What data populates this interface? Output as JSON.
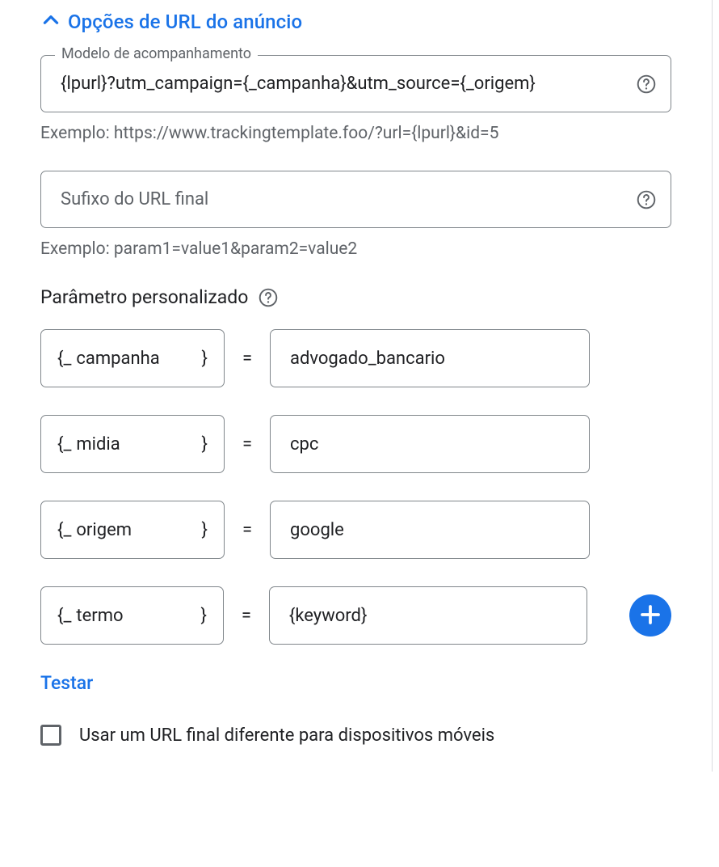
{
  "header": {
    "title": "Opções de URL do anúncio"
  },
  "tracking_template": {
    "label": "Modelo de acompanhamento",
    "value": "{lpurl}?utm_campaign={_campanha}&utm_source={_origem}",
    "example": "Exemplo: https://www.trackingtemplate.foo/?url={lpurl}&id=5"
  },
  "final_url_suffix": {
    "placeholder": "Sufixo do URL final",
    "value": "",
    "example": "Exemplo: param1=value1&param2=value2"
  },
  "custom_params": {
    "heading": "Parâmetro personalizado",
    "prefix": "{_",
    "suffix": "}",
    "eq": "=",
    "rows": [
      {
        "key": "campanha",
        "value": "advogado_bancario"
      },
      {
        "key": "midia",
        "value": "cpc"
      },
      {
        "key": "origem",
        "value": "google"
      },
      {
        "key": "termo",
        "value": "{keyword}"
      }
    ]
  },
  "test_link": "Testar",
  "mobile_checkbox": {
    "label": "Usar um URL final diferente para dispositivos móveis",
    "checked": false
  }
}
